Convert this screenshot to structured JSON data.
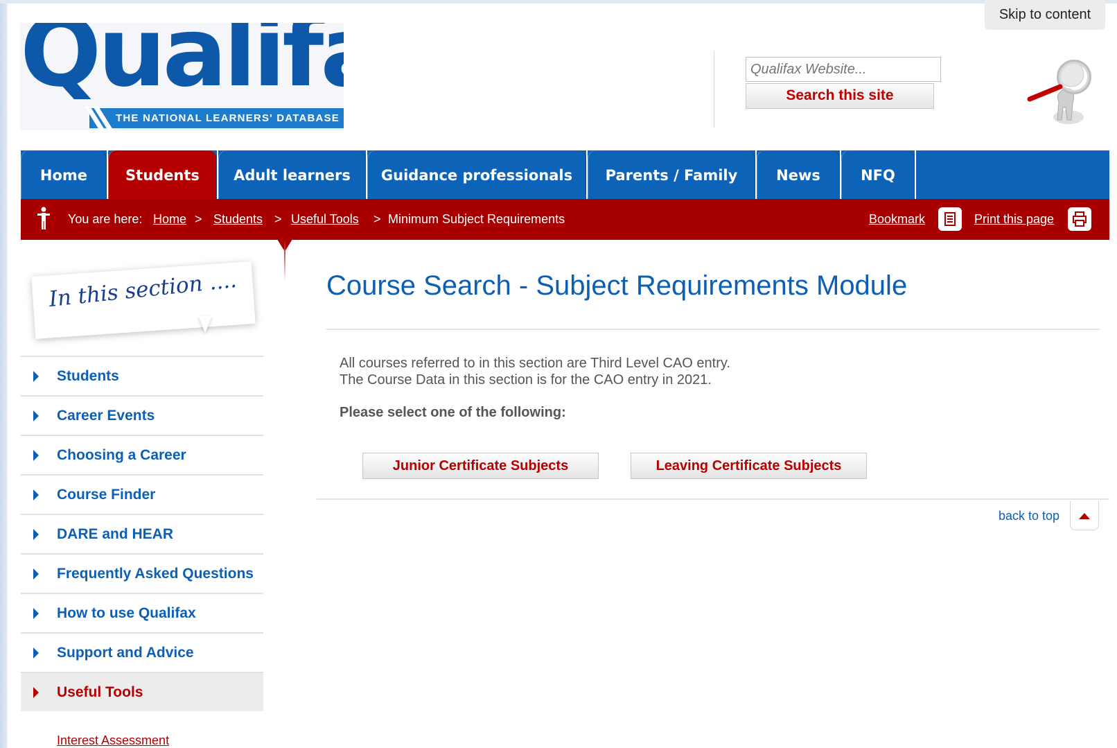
{
  "skip_link": "Skip to content",
  "logo": {
    "name": "Qualifax",
    "tagline": "THE NATIONAL LEARNERS' DATABASE"
  },
  "search": {
    "placeholder": "Qualifax Website...",
    "button_label": "Search this site"
  },
  "nav": {
    "items": [
      {
        "label": "Home",
        "active": false
      },
      {
        "label": "Students",
        "active": true
      },
      {
        "label": "Adult learners",
        "active": false
      },
      {
        "label": "Guidance professionals",
        "active": false
      },
      {
        "label": "Parents / Family",
        "active": false
      },
      {
        "label": "News",
        "active": false
      },
      {
        "label": "NFQ",
        "active": false
      }
    ]
  },
  "breadcrumb": {
    "prefix": "You are here:",
    "separator": ">",
    "items": [
      "Home",
      "Students",
      "Useful Tools",
      "Minimum Subject Requirements"
    ],
    "bookmark_label": "Bookmark",
    "print_label": "Print this page"
  },
  "sidebar": {
    "note": "In this section ....",
    "items": [
      {
        "label": "Students",
        "active": false
      },
      {
        "label": "Career Events",
        "active": false
      },
      {
        "label": "Choosing a Career",
        "active": false
      },
      {
        "label": "Course Finder",
        "active": false
      },
      {
        "label": "DARE and HEAR",
        "active": false
      },
      {
        "label": "Frequently Asked Questions",
        "active": false
      },
      {
        "label": "How to use Qualifax",
        "active": false
      },
      {
        "label": "Support and Advice",
        "active": false
      },
      {
        "label": "Useful Tools",
        "active": true
      }
    ],
    "sub_item": "Interest Assessment"
  },
  "main": {
    "title": "Course Search - Subject Requirements Module",
    "line1": "All courses referred to in this section are Third Level CAO entry.",
    "line2": "The Course Data in this section is for the CAO entry in 2021.",
    "prompt": "Please select one of the following:",
    "buttons": [
      "Junior Certificate Subjects",
      "Leaving Certificate Subjects"
    ],
    "back_to_top": "back to top"
  },
  "colors": {
    "brand_blue": "#0d63b8",
    "brand_red": "#a80000",
    "link_blue": "#0d5fb3"
  },
  "icons": [
    "walking-person-icon",
    "bookmark-icon",
    "print-icon",
    "magnifier-figure-icon",
    "up-arrow-icon"
  ]
}
